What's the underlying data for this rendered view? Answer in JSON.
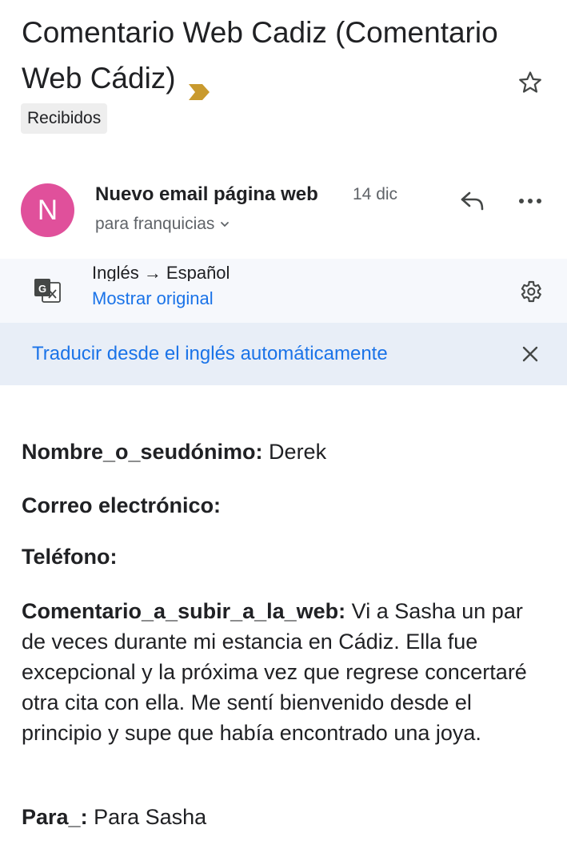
{
  "email": {
    "subject": "Comentario Web Cadiz (Comentario Web Cádiz)",
    "label": "Recibidos",
    "sender": {
      "initial": "N",
      "name": "Nuevo email página web",
      "date": "14 dic",
      "recipient": "para franquicias",
      "avatar_color": "#e0509b"
    },
    "translation": {
      "lang_pair": "Inglés → Español",
      "show_original": "Mostrar original",
      "auto_translate": "Traducir desde el inglés automáticamente"
    },
    "fields": [
      {
        "label": "Nombre_o_seudónimo:",
        "value": " Derek"
      },
      {
        "label": "Correo electrónico:",
        "value": ""
      },
      {
        "label": "Teléfono:",
        "value": ""
      },
      {
        "label": "Comentario_a_subir_a_la_web:",
        "value": " Vi a Sasha un par de veces durante mi estancia en Cádiz. Ella fue excepcional y la próxima vez que regrese concertaré otra cita con ella. Me sentí bienvenido desde el principio y supe que había encontrado una joya."
      },
      {
        "label": "Para_:",
        "value": " Para Sasha"
      }
    ]
  },
  "icons": {
    "importance": "importance-marker-icon",
    "star": "star-outline-icon",
    "reply": "reply-icon",
    "more": "more-horizontal-icon",
    "translate": "translate-icon",
    "settings": "gear-icon",
    "close": "close-icon",
    "chevron": "chevron-down-icon"
  },
  "colors": {
    "link": "#1a73e8",
    "importance": "#c99a2e",
    "translate_bar": "#f6f8fc",
    "auto_translate_bar": "#e8eef7"
  }
}
